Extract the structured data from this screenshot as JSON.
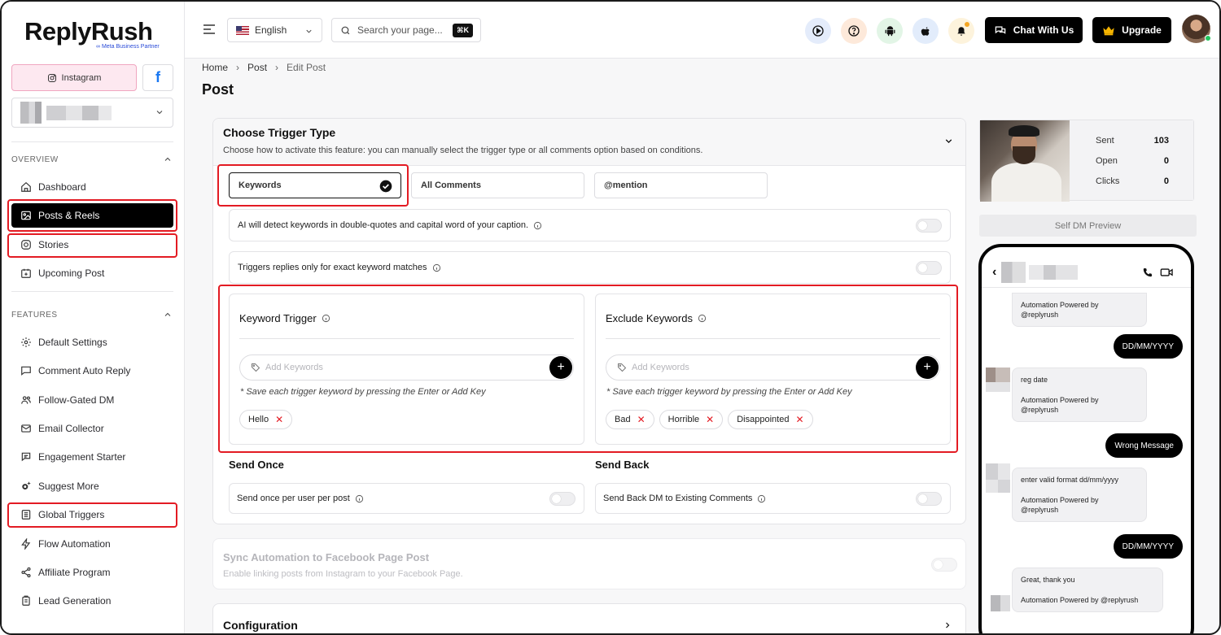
{
  "brand": {
    "name": "ReplyRush",
    "badge": "Meta Business Partner"
  },
  "platforms": {
    "instagram_label": "Instagram",
    "facebook_label": "f"
  },
  "sidebar": {
    "overview_title": "OVERVIEW",
    "overview_items": [
      {
        "label": "Dashboard",
        "icon": "home-icon"
      },
      {
        "label": "Posts & Reels",
        "icon": "image-icon"
      },
      {
        "label": "Stories",
        "icon": "instagram-icon"
      },
      {
        "label": "Upcoming Post",
        "icon": "calendar-plus-icon"
      }
    ],
    "features_title": "FEATURES",
    "feature_items": [
      {
        "label": "Default Settings",
        "icon": "gear-icon"
      },
      {
        "label": "Comment Auto Reply",
        "icon": "message-icon"
      },
      {
        "label": "Follow-Gated DM",
        "icon": "users-icon"
      },
      {
        "label": "Email Collector",
        "icon": "mail-icon"
      },
      {
        "label": "Engagement Starter",
        "icon": "chat-icon"
      },
      {
        "label": "Suggest More",
        "icon": "spark-gear-icon"
      },
      {
        "label": "Global Triggers",
        "icon": "list-icon"
      },
      {
        "label": "Flow Automation",
        "icon": "bolt-icon"
      },
      {
        "label": "Affiliate Program",
        "icon": "share-icon"
      },
      {
        "label": "Lead Generation",
        "icon": "clipboard-icon"
      }
    ]
  },
  "header": {
    "language": "English",
    "search_placeholder": "Search your page...",
    "search_shortcut": "⌘K",
    "chat_button": "Chat With Us",
    "upgrade_button": "Upgrade"
  },
  "breadcrumb": [
    "Home",
    "Post",
    "Edit Post"
  ],
  "page_title": "Post",
  "trigger": {
    "title": "Choose Trigger Type",
    "description": "Choose how to activate this feature: you can manually select the trigger type or all comments option based on conditions.",
    "options": [
      "Keywords",
      "All Comments",
      "@mention"
    ],
    "ai_detect_label": "AI will detect keywords in double-quotes and capital word of your caption.",
    "exact_match_label": "Triggers replies only for exact keyword matches",
    "keyword_trigger": {
      "title": "Keyword Trigger",
      "placeholder": "Add Keywords",
      "hint": "* Save each trigger keyword by pressing the Enter or Add Key",
      "chips": [
        "Hello"
      ]
    },
    "exclude_keywords": {
      "title": "Exclude Keywords",
      "placeholder": "Add Keywords",
      "hint": "* Save each trigger keyword by pressing the Enter or Add Key",
      "chips": [
        "Bad",
        "Horrible",
        "Disappointed"
      ]
    },
    "send_once": {
      "title": "Send Once",
      "label": "Send once per user per post"
    },
    "send_back": {
      "title": "Send Back",
      "label": "Send Back DM to Existing Comments"
    }
  },
  "sync": {
    "title": "Sync Automation to Facebook Page Post",
    "description": "Enable linking posts from Instagram to your Facebook Page."
  },
  "configuration": {
    "title": "Configuration"
  },
  "stats": {
    "sent_label": "Sent",
    "sent_value": "103",
    "open_label": "Open",
    "open_value": "0",
    "clicks_label": "Clicks",
    "clicks_value": "0"
  },
  "self_dm_preview": "Self DM Preview",
  "chat": {
    "msg1_powered": "Automation Powered by @replyrush",
    "out1": "DD/MM/YYYY",
    "msg2_text": "reg date",
    "msg2_powered": "Automation Powered by @replyrush",
    "out2": "Wrong Message",
    "msg3_text": "enter valid format dd/mm/yyyy",
    "msg3_powered": "Automation Powered by @replyrush",
    "out3": "DD/MM/YYYY",
    "msg4_text": "Great, thank you",
    "msg4_powered": "Automation Powered by @replyrush"
  },
  "colors": {
    "accent": "#000000",
    "highlight": "#e31b23",
    "instagram_bg": "#fde8f0",
    "facebook": "#1877f2"
  }
}
